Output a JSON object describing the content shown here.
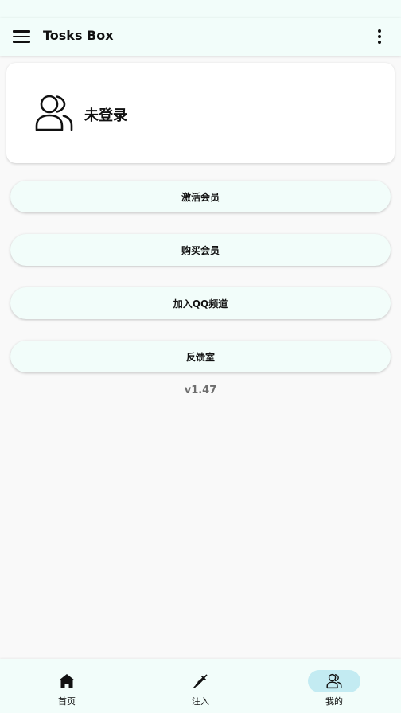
{
  "app_bar": {
    "title": "Tosks Box",
    "menu_icon": "hamburger-menu-icon",
    "overflow_icon": "more-vert-icon"
  },
  "profile": {
    "icon": "users-icon",
    "login_status": "未登录"
  },
  "actions": [
    {
      "label": "激活会员"
    },
    {
      "label": "购买会员"
    },
    {
      "label": "加入QQ频道"
    },
    {
      "label": "反馈室"
    }
  ],
  "version": "v1.47",
  "bottom_nav": {
    "items": [
      {
        "label": "首页",
        "icon": "home-icon",
        "active": false
      },
      {
        "label": "注入",
        "icon": "syringe-icon",
        "active": false
      },
      {
        "label": "我的",
        "icon": "users-icon",
        "active": true
      }
    ]
  },
  "colors": {
    "app_bar_bg": "#f2fdfa",
    "page_bg": "#f9f9f9",
    "card_bg": "#ffffff",
    "active_indicator": "#c3ebf2",
    "version_text": "#6e6e6e"
  }
}
